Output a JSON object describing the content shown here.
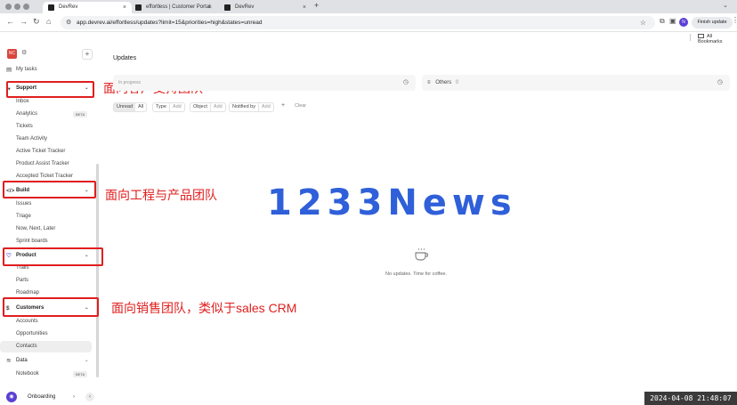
{
  "browser": {
    "tabs": [
      {
        "title": "DevRev",
        "active": true
      },
      {
        "title": "effortless | Customer Portal",
        "active": false
      },
      {
        "title": "DevRev",
        "active": false
      }
    ],
    "new_tab": "+",
    "close": "×",
    "url": "app.devrev.ai/effortless/updates?limit=15&priorities=high&states=unread",
    "profile_initial": "N",
    "finish_update": "Finish update",
    "all_bookmarks": "All Bookmarks"
  },
  "sidebar": {
    "org_initials": "NC",
    "my_tasks": "My tasks",
    "support": {
      "label": "Support",
      "items": [
        "Inbox",
        "Analytics",
        "Tickets",
        "Team Activity",
        "Active Ticket Tracker",
        "Product Assist Tracker",
        "Accepted Ticket Tracker"
      ],
      "analytics_badge": "BETA"
    },
    "build": {
      "label": "Build",
      "items": [
        "Issues",
        "Triage",
        "Now, Next, Later",
        "Sprint boards"
      ]
    },
    "product": {
      "label": "Product",
      "items": [
        "Trails",
        "Parts",
        "Roadmap"
      ]
    },
    "customers": {
      "label": "Customers",
      "items": [
        "Accounts",
        "Opportunities",
        "Contacts"
      ]
    },
    "data": {
      "label": "Data",
      "items": [
        "Notebook"
      ],
      "notebook_badge": "BETA"
    },
    "onboarding": "Onboarding"
  },
  "annotations": {
    "support": "面向客户支持团队",
    "build": "面向工程与产品团队",
    "customers": "面向销售团队，类似于sales CRM"
  },
  "main": {
    "title": "Updates",
    "panel_left": "In progress",
    "panel_right_label": "Others",
    "panel_right_count": "0",
    "filters": {
      "unread": "Unread",
      "all": "All",
      "type": "Type",
      "object": "Object",
      "notified_by": "Notified by",
      "add": "Add",
      "clear": "Clear"
    },
    "empty_message": "No updates. Time for coffee."
  },
  "watermark": "1233News",
  "timestamp": "2024-04-08 21:48:07",
  "colors": {
    "annotation": "#e01e1e",
    "brand": "#5b3fd3",
    "watermark": "#2f5fd9"
  }
}
